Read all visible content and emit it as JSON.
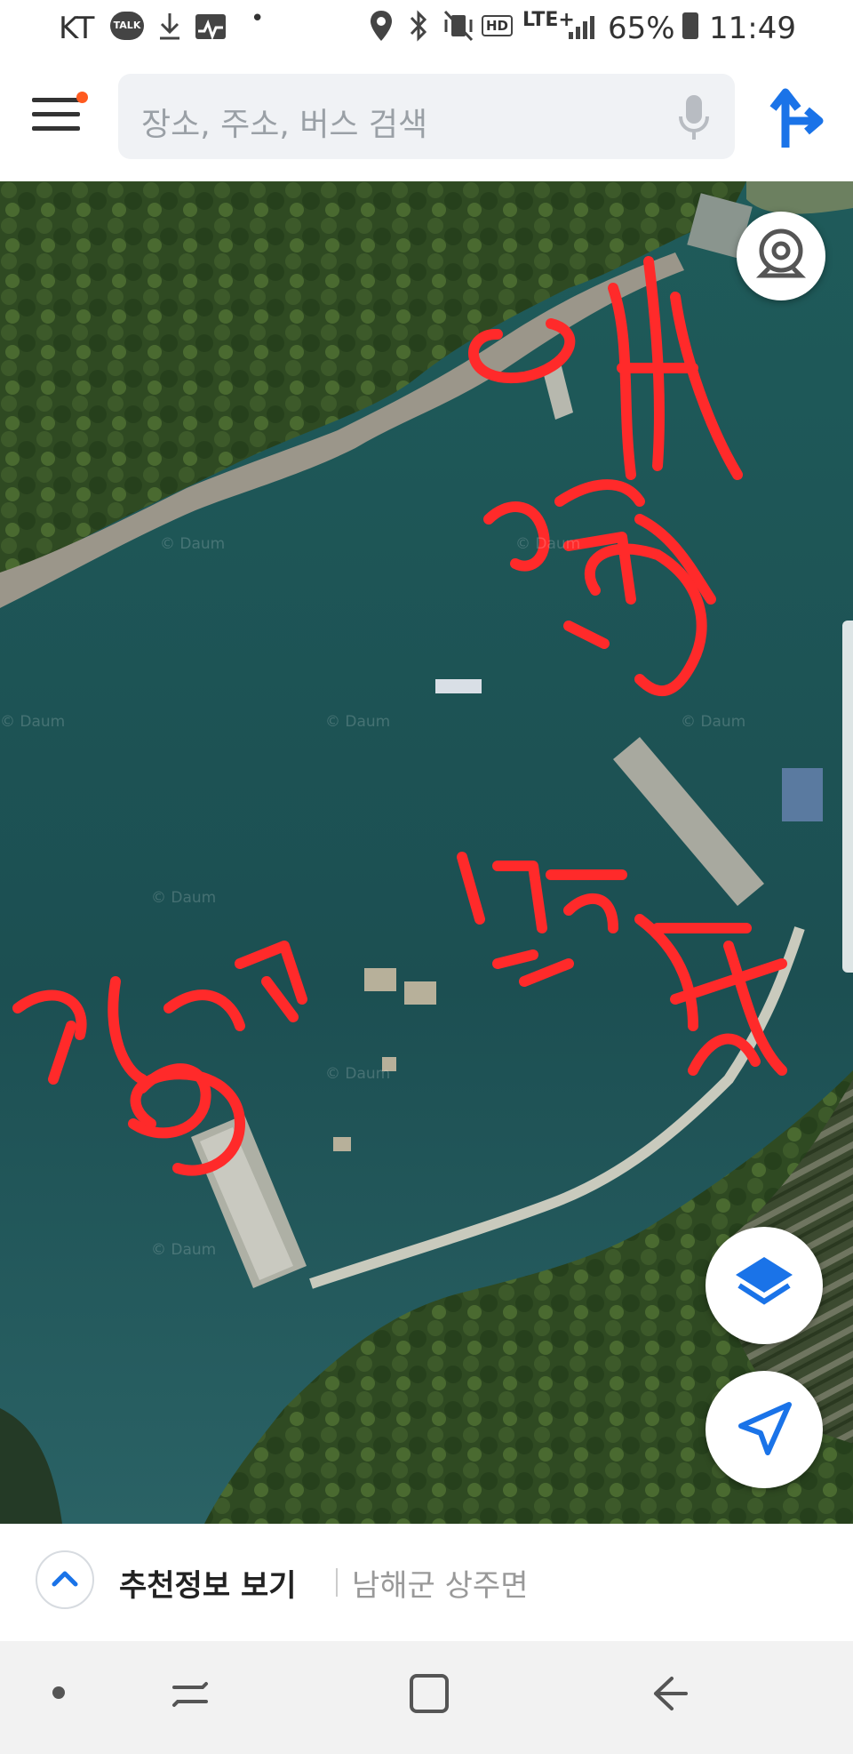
{
  "status_bar": {
    "carrier": "KT",
    "talk_badge": "TALK",
    "network": "LTE+",
    "hd_badge": "HD",
    "battery": "65%",
    "time": "11:49"
  },
  "search": {
    "placeholder": "장소, 주소, 버스 검색"
  },
  "map": {
    "watermark": "© Daum",
    "handwritten_annotations": [
      "감성돔",
      "볼락",
      "감성돔",
      "볼락",
      "갑오징어"
    ]
  },
  "bottom_bar": {
    "recommend_label": "추천정보 보기",
    "region_label": "남해군 상주면"
  },
  "colors": {
    "accent_blue": "#1a73e8",
    "badge_orange": "#ff5a1f",
    "sea": "#1e5050",
    "annotation_red": "#ff2a2a"
  },
  "icons": [
    "menu-icon",
    "mic-icon",
    "route-icon",
    "cctv-icon",
    "layers-icon",
    "my-location-icon"
  ]
}
